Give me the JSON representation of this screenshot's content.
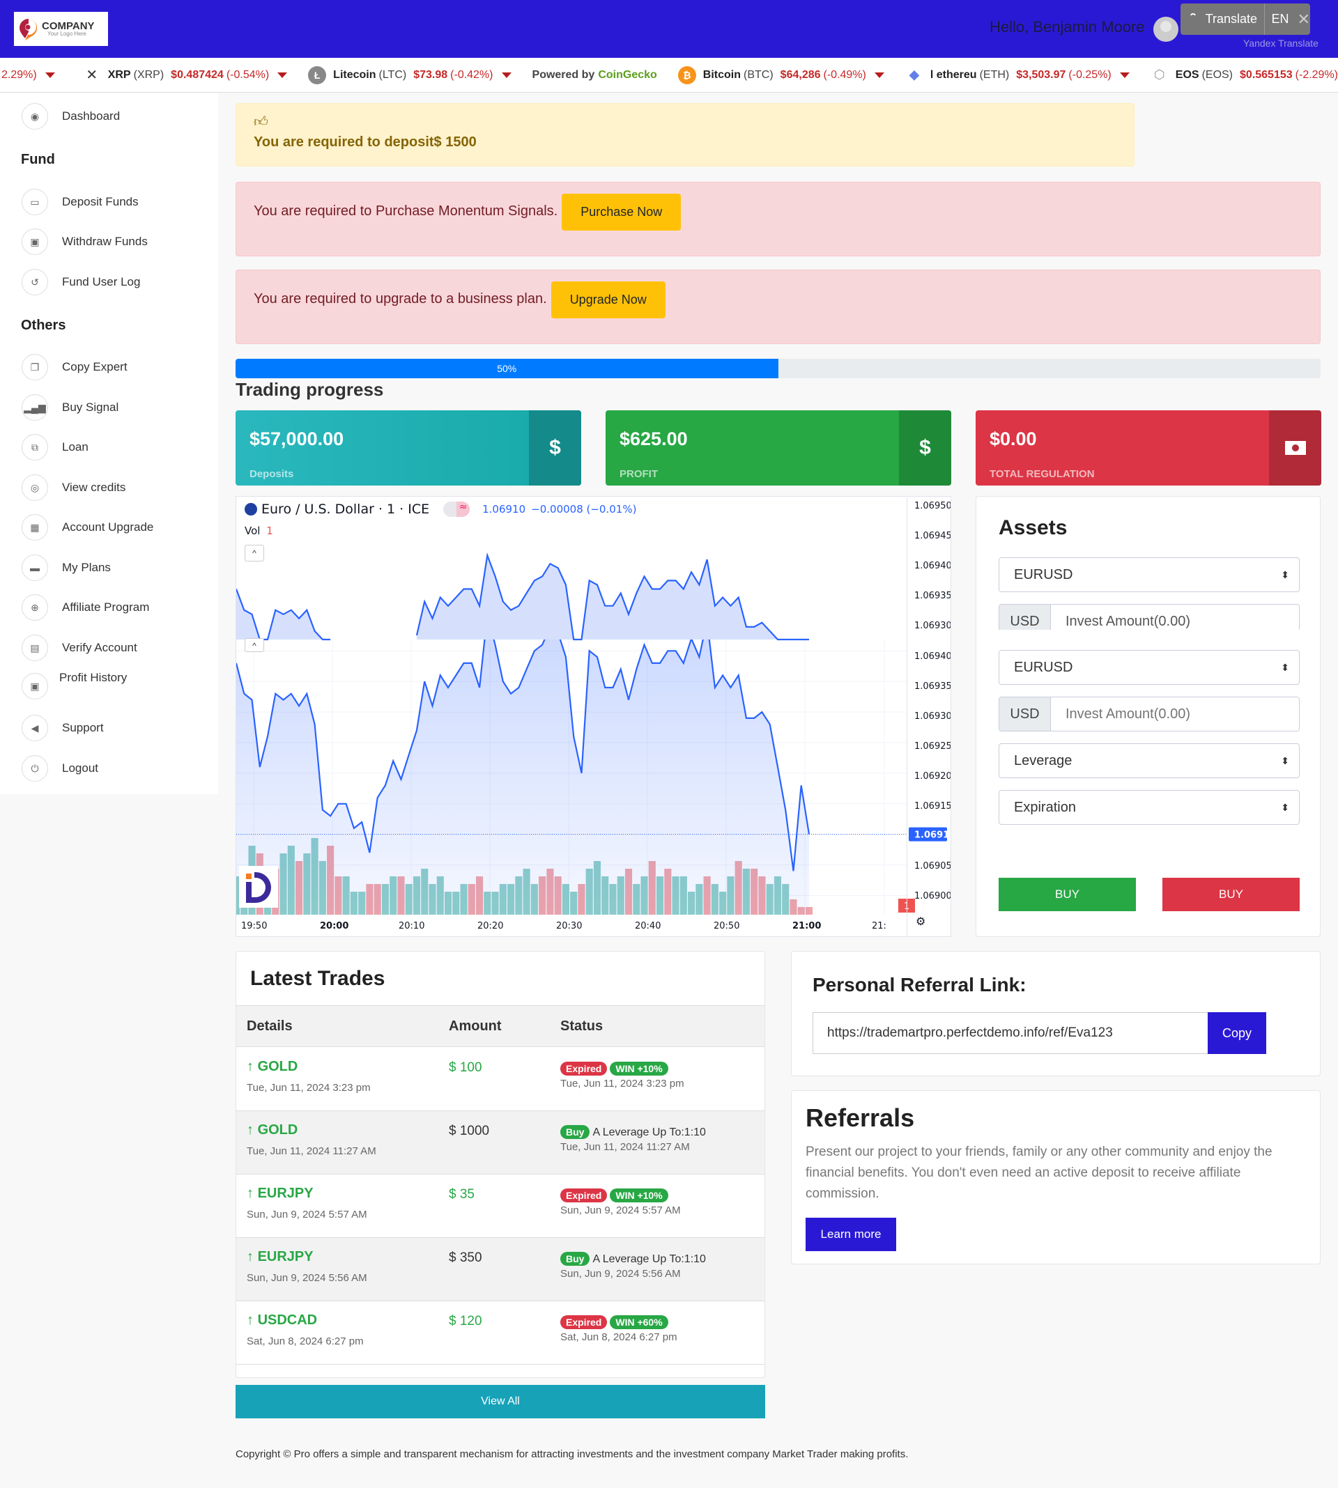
{
  "header": {
    "logo_title": "COMPANY",
    "logo_sub": "Your Logo Here",
    "greeting": "Hello, Benjamin Moore",
    "translate_label": "Translate",
    "translate_lang": "EN",
    "translate_provider": "Yandex Translate"
  },
  "ticker": {
    "powered_by": "Powered by",
    "powered_brand": "CoinGecko",
    "items": [
      {
        "name": "",
        "symbol": "",
        "price": "",
        "change": "2.29%)",
        "icon": "none"
      },
      {
        "name": "XRP",
        "symbol": "(XRP)",
        "price": "$0.487424",
        "change": "(-0.54%)",
        "icon": "xrp-icon"
      },
      {
        "name": "Litecoin",
        "symbol": "(LTC)",
        "price": "$73.98",
        "change": "(-0.42%)",
        "icon": "litecoin-icon"
      },
      {
        "name": "Bitcoin",
        "symbol": "(BTC)",
        "price": "$64,286",
        "change": "(-0.49%)",
        "icon": "bitcoin-icon"
      },
      {
        "name": "l ethereu",
        "symbol": "(ETH)",
        "price": "$3,503.97",
        "change": "(-0.25%)",
        "icon": "ethereum-icon"
      },
      {
        "name": "EOS",
        "symbol": "(EOS)",
        "price": "$0.565153",
        "change": "(-2.29%)",
        "icon": "eos-icon"
      }
    ]
  },
  "sidebar": {
    "dashboard": "Dashboard",
    "fund_heading": "Fund",
    "fund_items": [
      "Deposit Funds",
      "Withdraw Funds",
      "Fund User Log"
    ],
    "others_heading": "Others",
    "other_items": [
      "Copy Expert",
      "Buy Signal",
      "Loan",
      "View credits",
      "Account Upgrade",
      "My Plans",
      "Affiliate Program",
      "Verify Account",
      "Profit History",
      "Support",
      "Logout"
    ]
  },
  "alerts": {
    "deposit": "You are required to deposit$ 1500",
    "signals": "You are required to Purchase Monentum Signals.",
    "signals_btn": "Purchase Now",
    "upgrade": "You are required to upgrade to a business plan.",
    "upgrade_btn": "Upgrade Now"
  },
  "progress": {
    "value": 50,
    "label": "50%"
  },
  "trading_title": "Trading progress",
  "stats": [
    {
      "value": "$57,000.00",
      "label": "Deposits",
      "icon": "$",
      "color": "#20b2b2",
      "dark": "#148a8a"
    },
    {
      "value": "$625.00",
      "label": "PROFIT",
      "icon": "$",
      "color": "#28a745",
      "dark": "#1e8a38"
    },
    {
      "value": "$0.00",
      "label": "TOTAL REGULATION",
      "icon": "money-bill",
      "color": "#dc3545",
      "dark": "#b02a37"
    }
  ],
  "chart_data": {
    "type": "area",
    "title": "Euro / U.S. Dollar · 1 · ICE",
    "last_value": "1.06910",
    "change": "−0.00008 (−0.01%)",
    "vol_label": "Vol",
    "vol_value": "1",
    "x_ticks": [
      "19:50",
      "20:00",
      "20:10",
      "20:20",
      "20:30",
      "20:40",
      "20:50",
      "21:00",
      "21:"
    ],
    "y_ticks_top": [
      "1.06950",
      "1.06945",
      "1.06940",
      "1.06935",
      "1.06930"
    ],
    "y_ticks": [
      "1.06940",
      "1.06935",
      "1.06930",
      "1.06925",
      "1.06920",
      "1.06915",
      "1.06910",
      "1.06905",
      "1.06900"
    ],
    "ylim": [
      1.06898,
      1.06943
    ],
    "price_label": "1.06910",
    "badge": "1",
    "values": [
      1.06938,
      1.06933,
      1.06932,
      1.06921,
      1.06926,
      1.06933,
      1.06932,
      1.06933,
      1.06931,
      1.06933,
      1.06928,
      1.06914,
      1.06913,
      1.06915,
      1.06915,
      1.06911,
      1.06912,
      1.06907,
      1.06916,
      1.06918,
      1.06922,
      1.06919,
      1.06923,
      1.06927,
      1.06935,
      1.06931,
      1.06936,
      1.06934,
      1.06936,
      1.06938,
      1.06938,
      1.06934,
      1.06946,
      1.06941,
      1.06935,
      1.06933,
      1.06934,
      1.06937,
      1.0694,
      1.06941,
      1.06944,
      1.06943,
      1.06939,
      1.06926,
      1.0692,
      1.0694,
      1.06939,
      1.06934,
      1.06934,
      1.06937,
      1.06932,
      1.06937,
      1.06941,
      1.06938,
      1.06938,
      1.0694,
      1.0694,
      1.06938,
      1.06942,
      1.06939,
      1.06945,
      1.06934,
      1.06936,
      1.06934,
      1.06936,
      1.06929,
      1.06929,
      1.0693,
      1.06928,
      1.06921,
      1.06914,
      1.06904,
      1.06918,
      1.0691
    ],
    "volumes": [
      5,
      5,
      9,
      8,
      6,
      6,
      8,
      9,
      7,
      8,
      10,
      7,
      9,
      5,
      5,
      3,
      3,
      4,
      4,
      4,
      5,
      5,
      4,
      5,
      6,
      4,
      5,
      3,
      3,
      4,
      4,
      5,
      3,
      3,
      4,
      4,
      5,
      6,
      4,
      5,
      6,
      5,
      4,
      3,
      4,
      6,
      7,
      5,
      4,
      5,
      6,
      4,
      5,
      7,
      5,
      6,
      5,
      5,
      3,
      4,
      5,
      4,
      3,
      5,
      7,
      6,
      6,
      5,
      4,
      5,
      4,
      2,
      1,
      1
    ],
    "volume_up": [
      1,
      1,
      1,
      0,
      1,
      0,
      1,
      1,
      0,
      1,
      1,
      1,
      0,
      0,
      1,
      1,
      1,
      0,
      0,
      1,
      1,
      0,
      1,
      1,
      1,
      1,
      1,
      1,
      1,
      1,
      0,
      0,
      1,
      1,
      1,
      1,
      1,
      1,
      1,
      0,
      0,
      0,
      1,
      1,
      0,
      1,
      1,
      1,
      1,
      1,
      0,
      1,
      1,
      0,
      1,
      0,
      1,
      1,
      1,
      1,
      0,
      1,
      1,
      1,
      0,
      1,
      0,
      0,
      1,
      1,
      1,
      0,
      0,
      0
    ]
  },
  "assets": {
    "title": "Assets",
    "asset_select": "EURUSD",
    "currency": "USD",
    "amount_placeholder": "Invest Amount(0.00)",
    "leverage": "Leverage",
    "expiration": "Expiration",
    "buy_label": "BUY",
    "sell_label": "BUY"
  },
  "trades": {
    "title": "Latest Trades",
    "headers": [
      "Details",
      "Amount",
      "Status"
    ],
    "rows": [
      {
        "asset": "GOLD",
        "date": "Tue, Jun 11, 2024 3:23 pm",
        "amount": "$ 100",
        "amount_green": true,
        "status": "Expired",
        "result": "WIN +10%",
        "status_date": "Tue, Jun 11, 2024 3:23 pm"
      },
      {
        "asset": "GOLD",
        "date": "Tue, Jun 11, 2024 11:27 AM",
        "amount": "$ 1000",
        "amount_green": false,
        "status": "Buy",
        "result": "A Leverage Up To:1:10",
        "status_date": "Tue, Jun 11, 2024 11:27 AM"
      },
      {
        "asset": "EURJPY",
        "date": "Sun, Jun 9, 2024 5:57 AM",
        "amount": "$ 35",
        "amount_green": true,
        "status": "Expired",
        "result": "WIN +10%",
        "status_date": "Sun, Jun 9, 2024 5:57 AM"
      },
      {
        "asset": "EURJPY",
        "date": "Sun, Jun 9, 2024 5:56 AM",
        "amount": "$ 350",
        "amount_green": false,
        "status": "Buy",
        "result": "A Leverage Up To:1:10",
        "status_date": "Sun, Jun 9, 2024 5:56 AM"
      },
      {
        "asset": "USDCAD",
        "date": "Sat, Jun 8, 2024 6:27 pm",
        "amount": "$ 120",
        "amount_green": true,
        "status": "Expired",
        "result": "WIN +60%",
        "status_date": "Sat, Jun 8, 2024 6:27 pm"
      }
    ],
    "view_all": "View All"
  },
  "referral": {
    "title": "Personal Referral Link:",
    "link": "https://trademartpro.perfectdemo.info/ref/Eva123",
    "copy": "Copy"
  },
  "referrals": {
    "title": "Referrals",
    "text": "Present our project to your friends, family or any other community and enjoy the financial benefits. You don't even need an active deposit to receive affiliate commission.",
    "button": "Learn more"
  },
  "footer": "Copyright © Pro offers a simple and transparent mechanism for attracting investments and the investment company Market Trader making profits."
}
